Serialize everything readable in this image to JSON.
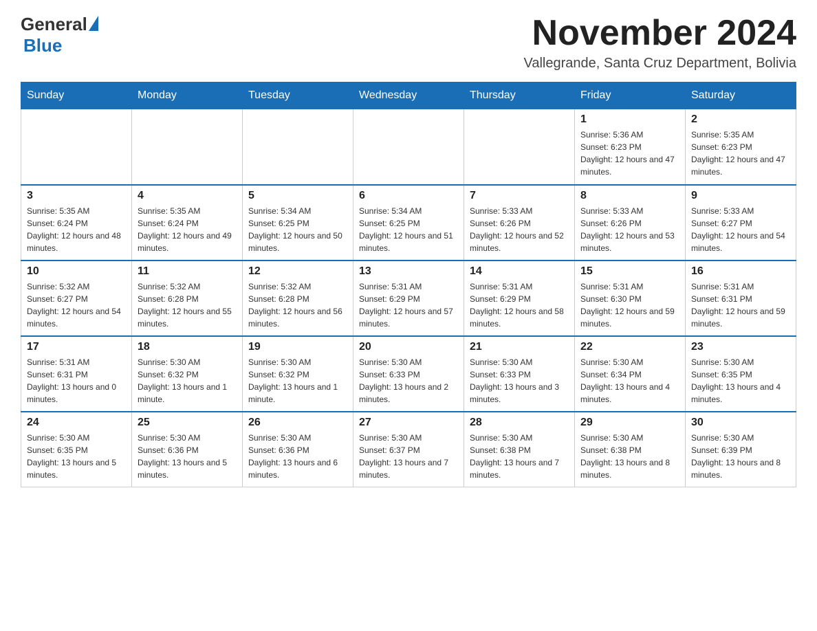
{
  "logo": {
    "general": "General",
    "blue": "Blue",
    "sub": ""
  },
  "header": {
    "month_year": "November 2024",
    "location": "Vallegrande, Santa Cruz Department, Bolivia"
  },
  "days_of_week": [
    "Sunday",
    "Monday",
    "Tuesday",
    "Wednesday",
    "Thursday",
    "Friday",
    "Saturday"
  ],
  "weeks": [
    [
      {
        "day": "",
        "info": ""
      },
      {
        "day": "",
        "info": ""
      },
      {
        "day": "",
        "info": ""
      },
      {
        "day": "",
        "info": ""
      },
      {
        "day": "",
        "info": ""
      },
      {
        "day": "1",
        "info": "Sunrise: 5:36 AM\nSunset: 6:23 PM\nDaylight: 12 hours and 47 minutes."
      },
      {
        "day": "2",
        "info": "Sunrise: 5:35 AM\nSunset: 6:23 PM\nDaylight: 12 hours and 47 minutes."
      }
    ],
    [
      {
        "day": "3",
        "info": "Sunrise: 5:35 AM\nSunset: 6:24 PM\nDaylight: 12 hours and 48 minutes."
      },
      {
        "day": "4",
        "info": "Sunrise: 5:35 AM\nSunset: 6:24 PM\nDaylight: 12 hours and 49 minutes."
      },
      {
        "day": "5",
        "info": "Sunrise: 5:34 AM\nSunset: 6:25 PM\nDaylight: 12 hours and 50 minutes."
      },
      {
        "day": "6",
        "info": "Sunrise: 5:34 AM\nSunset: 6:25 PM\nDaylight: 12 hours and 51 minutes."
      },
      {
        "day": "7",
        "info": "Sunrise: 5:33 AM\nSunset: 6:26 PM\nDaylight: 12 hours and 52 minutes."
      },
      {
        "day": "8",
        "info": "Sunrise: 5:33 AM\nSunset: 6:26 PM\nDaylight: 12 hours and 53 minutes."
      },
      {
        "day": "9",
        "info": "Sunrise: 5:33 AM\nSunset: 6:27 PM\nDaylight: 12 hours and 54 minutes."
      }
    ],
    [
      {
        "day": "10",
        "info": "Sunrise: 5:32 AM\nSunset: 6:27 PM\nDaylight: 12 hours and 54 minutes."
      },
      {
        "day": "11",
        "info": "Sunrise: 5:32 AM\nSunset: 6:28 PM\nDaylight: 12 hours and 55 minutes."
      },
      {
        "day": "12",
        "info": "Sunrise: 5:32 AM\nSunset: 6:28 PM\nDaylight: 12 hours and 56 minutes."
      },
      {
        "day": "13",
        "info": "Sunrise: 5:31 AM\nSunset: 6:29 PM\nDaylight: 12 hours and 57 minutes."
      },
      {
        "day": "14",
        "info": "Sunrise: 5:31 AM\nSunset: 6:29 PM\nDaylight: 12 hours and 58 minutes."
      },
      {
        "day": "15",
        "info": "Sunrise: 5:31 AM\nSunset: 6:30 PM\nDaylight: 12 hours and 59 minutes."
      },
      {
        "day": "16",
        "info": "Sunrise: 5:31 AM\nSunset: 6:31 PM\nDaylight: 12 hours and 59 minutes."
      }
    ],
    [
      {
        "day": "17",
        "info": "Sunrise: 5:31 AM\nSunset: 6:31 PM\nDaylight: 13 hours and 0 minutes."
      },
      {
        "day": "18",
        "info": "Sunrise: 5:30 AM\nSunset: 6:32 PM\nDaylight: 13 hours and 1 minute."
      },
      {
        "day": "19",
        "info": "Sunrise: 5:30 AM\nSunset: 6:32 PM\nDaylight: 13 hours and 1 minute."
      },
      {
        "day": "20",
        "info": "Sunrise: 5:30 AM\nSunset: 6:33 PM\nDaylight: 13 hours and 2 minutes."
      },
      {
        "day": "21",
        "info": "Sunrise: 5:30 AM\nSunset: 6:33 PM\nDaylight: 13 hours and 3 minutes."
      },
      {
        "day": "22",
        "info": "Sunrise: 5:30 AM\nSunset: 6:34 PM\nDaylight: 13 hours and 4 minutes."
      },
      {
        "day": "23",
        "info": "Sunrise: 5:30 AM\nSunset: 6:35 PM\nDaylight: 13 hours and 4 minutes."
      }
    ],
    [
      {
        "day": "24",
        "info": "Sunrise: 5:30 AM\nSunset: 6:35 PM\nDaylight: 13 hours and 5 minutes."
      },
      {
        "day": "25",
        "info": "Sunrise: 5:30 AM\nSunset: 6:36 PM\nDaylight: 13 hours and 5 minutes."
      },
      {
        "day": "26",
        "info": "Sunrise: 5:30 AM\nSunset: 6:36 PM\nDaylight: 13 hours and 6 minutes."
      },
      {
        "day": "27",
        "info": "Sunrise: 5:30 AM\nSunset: 6:37 PM\nDaylight: 13 hours and 7 minutes."
      },
      {
        "day": "28",
        "info": "Sunrise: 5:30 AM\nSunset: 6:38 PM\nDaylight: 13 hours and 7 minutes."
      },
      {
        "day": "29",
        "info": "Sunrise: 5:30 AM\nSunset: 6:38 PM\nDaylight: 13 hours and 8 minutes."
      },
      {
        "day": "30",
        "info": "Sunrise: 5:30 AM\nSunset: 6:39 PM\nDaylight: 13 hours and 8 minutes."
      }
    ]
  ]
}
